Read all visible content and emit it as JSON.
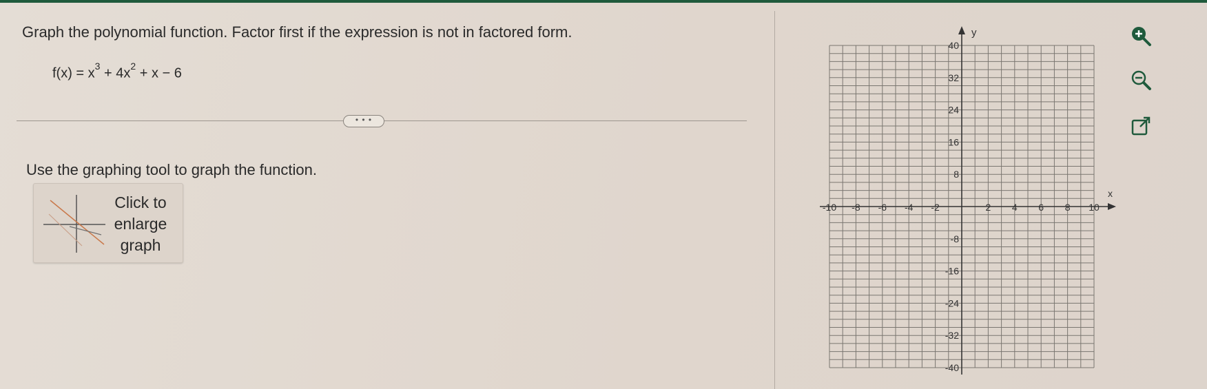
{
  "problem": {
    "instruction": "Graph the polynomial function. Factor first if the expression is not in factored form.",
    "function_prefix": "f(x) = x",
    "exp1": "3",
    "mid": " + 4x",
    "exp2": "2",
    "suffix": " + x − 6"
  },
  "more_button_label": "• • •",
  "graph_prompt": "Use the graphing tool to graph the function.",
  "enlarge_button": {
    "line1": "Click to",
    "line2": "enlarge",
    "line3": "graph"
  },
  "graph": {
    "x_axis_label": "x",
    "y_axis_label": "y",
    "x_ticks": [
      "-10",
      "-8",
      "-6",
      "-4",
      "-2",
      "2",
      "4",
      "6",
      "8",
      "10"
    ],
    "y_ticks": [
      "40",
      "32",
      "24",
      "16",
      "8",
      "-8",
      "-16",
      "-24",
      "-32",
      "-40"
    ],
    "x_range": [
      -10,
      10
    ],
    "y_range": [
      -40,
      40
    ],
    "grid": true
  },
  "toolbar": {
    "zoom_in": "zoom-in-icon",
    "zoom_out": "zoom-out-icon",
    "popout": "popout-icon"
  },
  "colors": {
    "accent": "#1f5a3c",
    "grid": "#7a7670",
    "axis": "#333333"
  }
}
